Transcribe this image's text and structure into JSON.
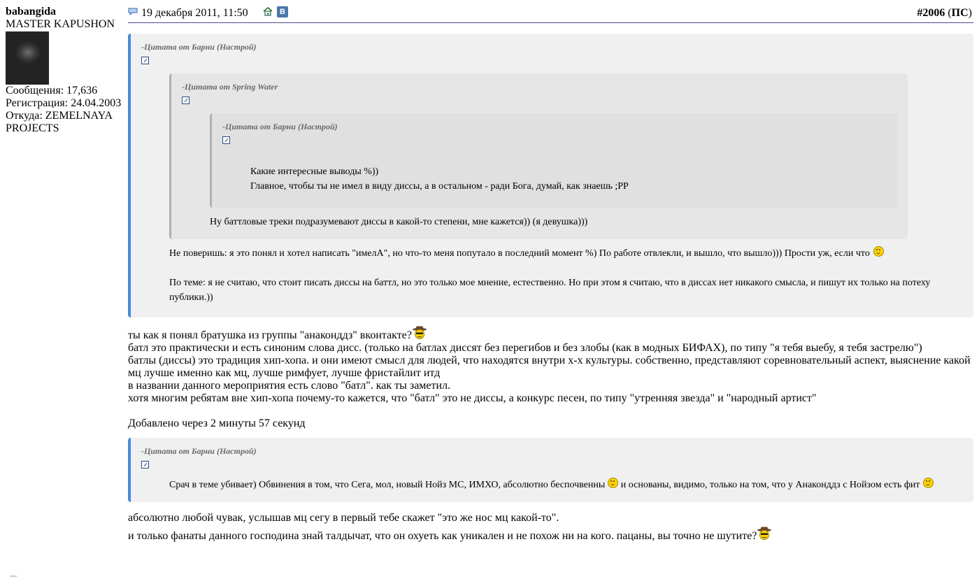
{
  "author": {
    "username": "babangida",
    "title": "MASTER KAPUSHON",
    "posts": "Сообщения: 17,636",
    "registered": "Регистрация: 24.04.2003",
    "location_line1": "Откуда: ZEMELNAYA",
    "location_line2": "PROJECTS"
  },
  "post": {
    "date": "19 декабря 2011, 11:50",
    "number": "#2006",
    "tag_open": " (",
    "tag": "ПС",
    "tag_close": ")",
    "vk_label": "B",
    "icons": [
      "post-icon",
      "home-icon",
      "vk-icon"
    ]
  },
  "quote1": {
    "author": "-Цитата от Барни (Настрой)",
    "nested": {
      "author": "-Цитата от Spring Water",
      "nested": {
        "author": "-Цитата от Барни (Настрой)",
        "line1": "Какие интересные выводы %))",
        "line2": "Главное, чтобы ты не имел в виду диссы, а в остальном - ради Бога, думай, как знаешь ;PP"
      },
      "reply": "Ну баттловые треки подразумевают диссы в какой-то степени, мне кажется)) (я девушка)))"
    },
    "reply1": "Не поверишь: я это понял и хотел написать \"имелА\", но что-то меня попутало в последний момент %) По работе отвлекли, и вышло, что вышло))) Прости уж, если что",
    "reply2": "По теме: я не считаю, что стоит писать диссы на баттл, но это только мое мнение, естественно. Но при этом я считаю, что в диссах нет никакого смысла, и пишут их только на потеху публики.))"
  },
  "body1": {
    "line1": "ты как я понял братушка из группы \"анаконддз\" вконтакте?",
    "line2": "батл это практически и есть синоним слова дисс. (только на батлах диссят без перегибов и без злобы (как в модных БИФАХ), по типу \"я тебя выебу, я тебя застрелю\")",
    "line3": "батлы (диссы) это традиция хип-хопа. и они имеют смысл для людей, что находятся внутри х-х культуры. собственно, представляют соревновательный аспект, выяснение какой мц лучше именно как мц, лучше римфует, лучше фристайлит итд",
    "line4": "в названии данного мероприятия есть слово \"батл\". как ты заметил.",
    "line5": "хотя многим ребятам вне хип-хопа почему-то кажется, что \"батл\" это не диссы, а конкурс песен, по типу \"утренняя звезда\" и \"народный артист\""
  },
  "added": "Добавлено через 2 минуты 57 секунд",
  "quote2": {
    "author": "-Цитата от Барни (Настрой)",
    "text_part1": "Срач в теме убивает) Обвинения в том, что Сега, мол, новый Нойз МС, ИМХО, абсолютно беспочвенны",
    "text_part2": " и основаны, видимо, только на том, что у Анаконддз с Нойзом есть фит"
  },
  "body2": {
    "line1": "абсолютно любой чувак, услышав мц сегу в первый тебе скажет \"это же нос мц какой-то\".",
    "line2": "и только фанаты данного господина знай талдычат, что он охуеть как уникален и не похож ни на кого. пацаны, вы точно не шутите?"
  },
  "colors": {
    "quote_border": "#4a8ad8",
    "quote_bg": "#f0f0f0",
    "header_rule": "#4a4a8a",
    "vk": "#4a76a8"
  }
}
